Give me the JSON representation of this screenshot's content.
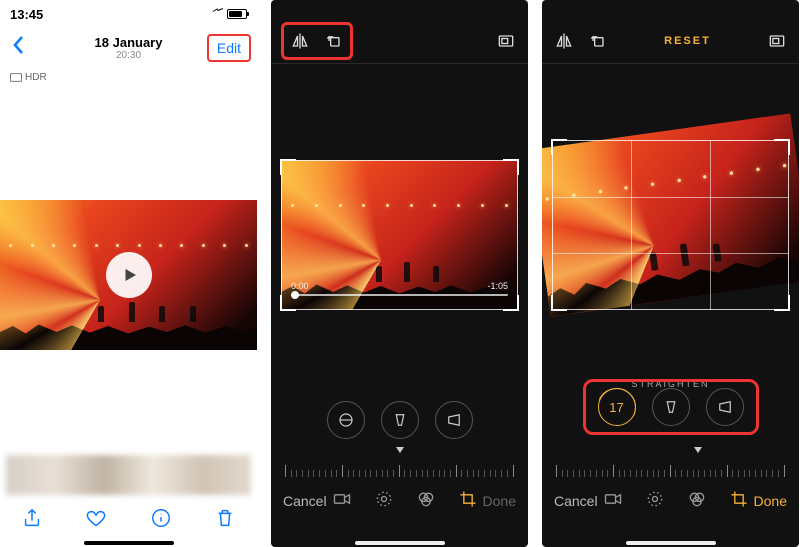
{
  "screen1": {
    "status_time": "13:45",
    "date": "18 January",
    "time": "20:30",
    "edit": "Edit",
    "hdr": "HDR"
  },
  "screen2": {
    "trim_start": "0:00",
    "trim_end": "-1:05",
    "cancel": "Cancel",
    "done": "Done"
  },
  "screen3": {
    "reset": "RESET",
    "label": "STRAIGHTEN",
    "value": "17",
    "cancel": "Cancel",
    "done": "Done"
  }
}
